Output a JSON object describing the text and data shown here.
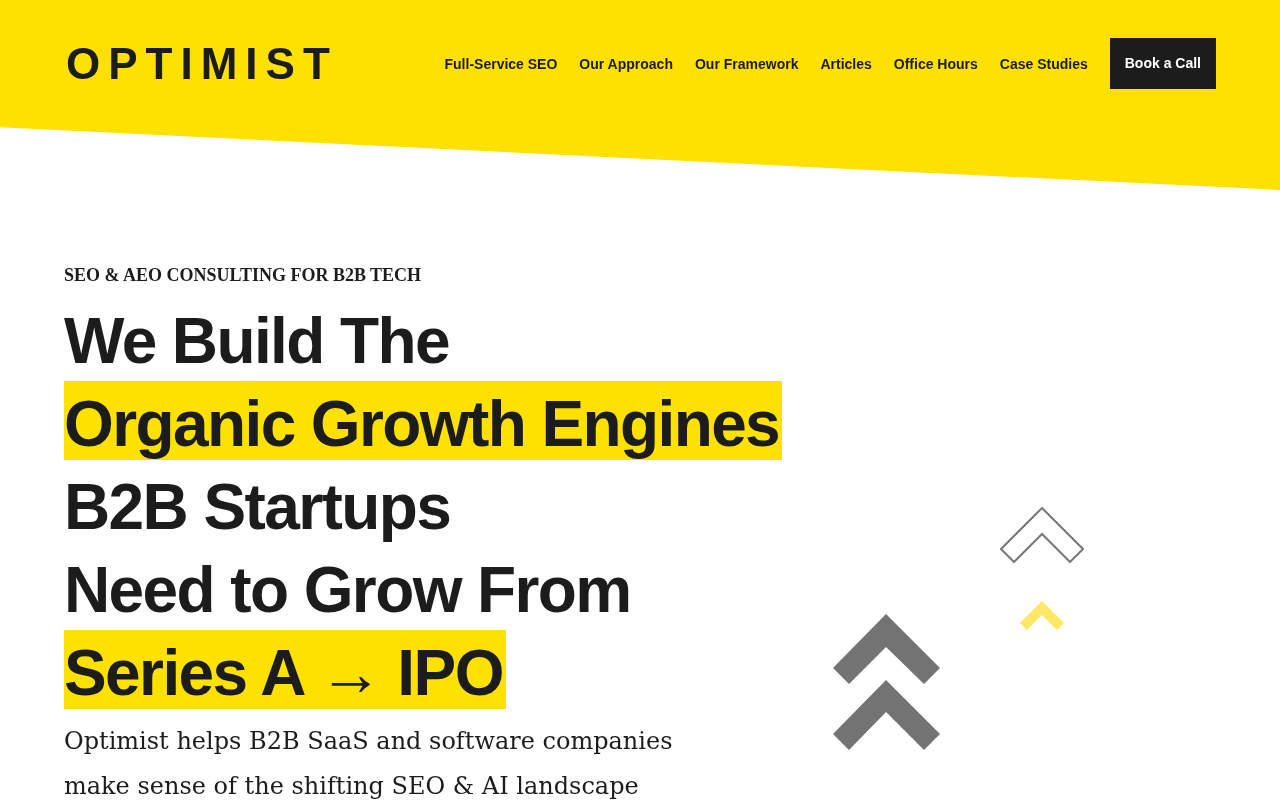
{
  "header": {
    "logo": "OPTIMIST",
    "nav": [
      "Full-Service SEO",
      "Our Approach",
      "Our Framework",
      "Articles",
      "Office Hours",
      "Case Studies"
    ],
    "cta": "Book a Call"
  },
  "hero": {
    "eyebrow": "SEO & AEO CONSULTING FOR B2B TECH",
    "headline": [
      {
        "text": "We Build The",
        "highlighted": false
      },
      {
        "text": "Organic Growth Engines",
        "highlighted": true
      },
      {
        "text": "B2B Startups",
        "highlighted": false
      },
      {
        "text": "Need to Grow From",
        "highlighted": false
      },
      {
        "text": "Series A → IPO",
        "highlighted": true
      }
    ],
    "description": "Optimist helps B2B SaaS and software companies make sense of the shifting SEO & AI landscape"
  }
}
